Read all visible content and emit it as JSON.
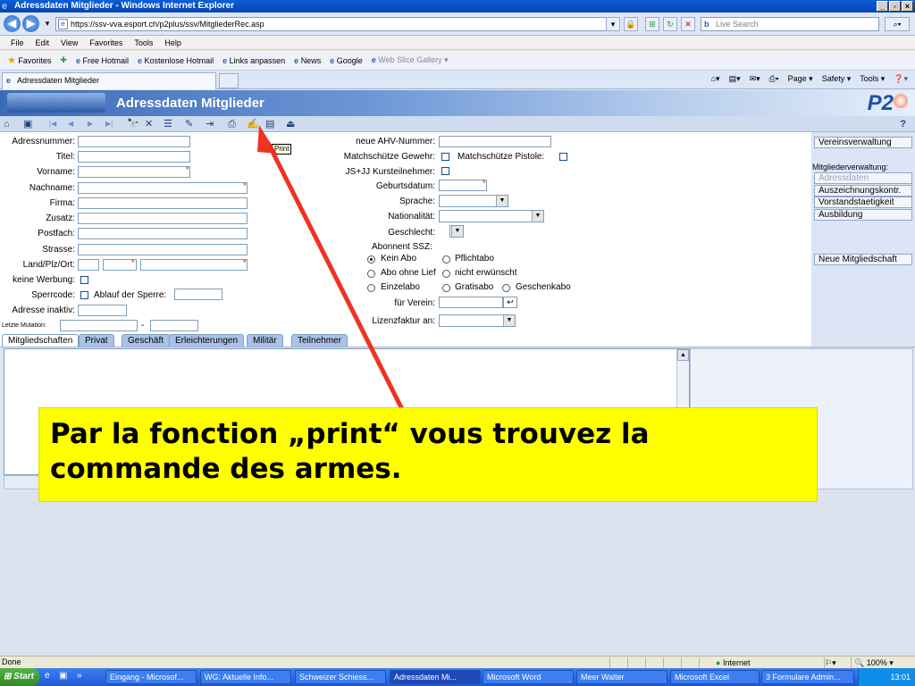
{
  "window": {
    "title": "Adressdaten Mitglieder - Windows Internet Explorer",
    "min": "_",
    "max": "▫",
    "close": "×"
  },
  "browser": {
    "url": "https://ssv-vva.esport.ch/p2plus/ssv/MitgliederRec.asp",
    "search_placeholder": "Live Search",
    "menu": [
      "File",
      "Edit",
      "View",
      "Favorites",
      "Tools",
      "Help"
    ],
    "favorites_label": "Favorites",
    "favorites": [
      "Free Hotmail",
      "Kostenlose Hotmail",
      "Links anpassen",
      "News",
      "Google",
      "Web Slice Gallery ▾"
    ],
    "tab_title": "Adressdaten Mitglieder",
    "commands": [
      "Page ▾",
      "Safety ▾",
      "Tools ▾"
    ]
  },
  "app": {
    "title": "Adressdaten Mitglieder",
    "logo": "P2",
    "logo_sub": "PLUS",
    "help": "?",
    "tooltip": "Print"
  },
  "form": {
    "left_labels": [
      "Adressnummer:",
      "Titel:",
      "Vorname:",
      "Nachname:",
      "Firma:",
      "Zusatz:",
      "Postfach:",
      "Strasse:",
      "Land/Plz/Ort:",
      "keine Werbung:",
      "Sperrcode:",
      "Adresse inaktiv:",
      "Letzte Mutation:"
    ],
    "ablauf_label": "Ablauf der Sperre:",
    "mutation_sep": "-",
    "mid_labels": [
      "neue AHV-Nummer:",
      "Matchschütze Gewehr:",
      "JS+JJ Kursteilnehmer:",
      "Geburtsdatum:",
      "Sprache:",
      "Nationalität:",
      "Geschlecht:"
    ],
    "pistole_label": "Matchschütze Pistole:",
    "abo_heading": "Abonnent SSZ:",
    "abo_options": [
      "Kein Abo",
      "Pflichtabo",
      "Abo ohne Lief",
      "nicht erwünscht",
      "Einzelabo",
      "Gratisabo",
      "Geschenkabo"
    ],
    "verein_label": "für Verein:",
    "lizenz_label": "Lizenzfaktur an:"
  },
  "right_panel": {
    "vereinsverwaltung": "Vereinsverwaltung",
    "mitglieder_heading": "Mitgliederverwaltung:",
    "items": [
      "Adressdaten",
      "Auszeichnungskontr.",
      "Vorstandstaetigkeit",
      "Ausbildung"
    ],
    "neue": "Neue Mitgliedschaft"
  },
  "tabs": [
    "Mitgliedschaften",
    "Privat",
    "Geschäft",
    "Erleichterungen",
    "Militär",
    "Teilnehmer"
  ],
  "status": {
    "left": "Done",
    "zone": "Internet",
    "zoom": "100%"
  },
  "taskbar": {
    "start": "Start",
    "tasks": [
      "Eingang - Microsof...",
      "WG: Aktuelle Info...",
      "Schweizer Schiess...",
      "Adressdaten Mi...",
      "Microsoft Word",
      "Meer Walter",
      "Microsoft Excel",
      "3 Formulare Admin..."
    ],
    "clock": "13:01"
  },
  "annotation": {
    "text": "Par la fonction „print“ vous trouvez la commande des armes."
  },
  "colors": {
    "accent": "#ffff00",
    "arrow": "#ee3322",
    "required": "#e00000"
  }
}
